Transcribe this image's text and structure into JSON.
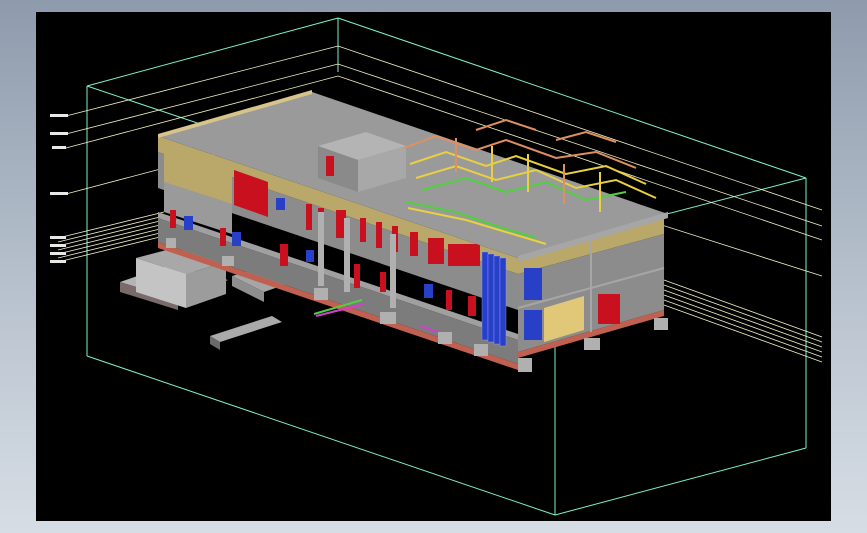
{
  "window": {
    "title": "",
    "background": "#000000",
    "frame_color": "#9aa6b5"
  },
  "model": {
    "type": "3D isometric building model (CAD)",
    "level_labels": [
      "",
      "",
      "",
      "",
      "",
      "",
      "",
      "",
      ""
    ],
    "colors": {
      "bounding_box": "#7ef2c8",
      "wall_grey": "#8c8c8c",
      "roof_grey": "#9a9a9a",
      "facade_tan": "#b9a86a",
      "window_blue": "#2840c8",
      "door_red": "#c8101e",
      "pipe_yellow": "#e8d040",
      "pipe_orange": "#e09060",
      "pipe_green": "#50d040",
      "level_line": "#f2f2c4",
      "base_plinth": "#b0b0b0"
    }
  }
}
